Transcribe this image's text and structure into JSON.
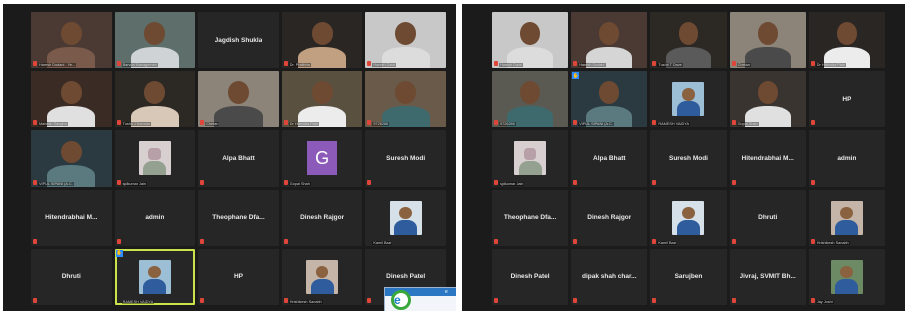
{
  "left_gallery": {
    "tiles": [
      {
        "type": "video",
        "label": "Haresh Dodani - Ye...",
        "muted": true,
        "bg": "#4a3a33",
        "body": "#7a5a4a"
      },
      {
        "type": "video",
        "label": "Barvda Managemen",
        "muted": true,
        "bg": "#5e6e6a",
        "body": "#cfd3d6"
      },
      {
        "type": "name",
        "name": "Jagdish Shukla",
        "muted": false
      },
      {
        "type": "video",
        "label": "Dr. Pratibha",
        "muted": true,
        "bg": "#2a2624",
        "body": "#c0a080"
      },
      {
        "type": "video",
        "label": "Haresh Dalal",
        "muted": true,
        "bg": "#c8c8c8",
        "body": "#dcdcdc"
      },
      {
        "type": "video",
        "label": "Mahesh Sanghvi",
        "muted": true,
        "bg": "#3a2c24",
        "body": "#e0e0e0"
      },
      {
        "type": "video",
        "label": "Tushti J Kamdar",
        "muted": true,
        "bg": "#2c2824",
        "body": "#d8c8b8"
      },
      {
        "type": "video",
        "label": "Chetan",
        "muted": true,
        "bg": "#8c8478",
        "body": "#4a4a4a"
      },
      {
        "type": "video",
        "label": "Dr Hitendra Pate",
        "muted": true,
        "bg": "#5a5040",
        "body": "#ececec"
      },
      {
        "type": "video",
        "label": "9726266",
        "muted": true,
        "bg": "#6a5a4a",
        "body": "#3e6a6e"
      },
      {
        "type": "video",
        "label": "VIPUL SIPANI (A.C.",
        "muted": true,
        "bg": "#2a3a40",
        "body": "#5a7a80"
      },
      {
        "type": "thumb",
        "style": "flower",
        "label": "sjdkumar Jain",
        "muted": true
      },
      {
        "type": "name",
        "name": "Alpa Bhatt",
        "muted": true
      },
      {
        "type": "letter",
        "letter": "G",
        "label": "Gopal Shah",
        "muted": true
      },
      {
        "type": "name",
        "name": "Suresh Modi",
        "muted": true
      },
      {
        "type": "name",
        "name": "Hitendrabhai M...",
        "muted": true
      },
      {
        "type": "name",
        "name": "admin",
        "muted": true
      },
      {
        "type": "name",
        "name": "Theophane Dfa...",
        "muted": true
      },
      {
        "type": "name",
        "name": "Dinesh Rajgor",
        "muted": true
      },
      {
        "type": "thumb",
        "style": "blue",
        "label": "Kamil Bazi",
        "muted": false
      },
      {
        "type": "name",
        "name": "Dhruti",
        "muted": true
      },
      {
        "type": "thumb",
        "style": "light",
        "label": "RAMESH VAIDYA",
        "muted": false,
        "active": true,
        "hand": true
      },
      {
        "type": "name",
        "name": "HP",
        "muted": true
      },
      {
        "type": "thumb",
        "style": "photo",
        "label": "Hrishikesh Sanabh",
        "muted": true
      },
      {
        "type": "name",
        "name": "Dinesh Patel",
        "muted": true
      }
    ],
    "popup": {
      "logo_letter": "e",
      "text": "e"
    }
  },
  "right_gallery": {
    "tiles": [
      {
        "type": "video",
        "label": "Haresh Dalal",
        "muted": true,
        "bg": "#c8c8c8",
        "body": "#dcdcdc"
      },
      {
        "type": "video",
        "label": "Haresh Dodani",
        "muted": true,
        "bg": "#4a3a33",
        "body": "#d5d5d5"
      },
      {
        "type": "video",
        "label": "Tushti T Dave",
        "muted": true,
        "bg": "#2c2824",
        "body": "#5a5a5a"
      },
      {
        "type": "video",
        "label": "Chetan",
        "muted": true,
        "bg": "#8c8478",
        "body": "#4a4a4a"
      },
      {
        "type": "video",
        "label": "Dr Hitendra Pate",
        "muted": true,
        "bg": "#2a2624",
        "body": "#ececec"
      },
      {
        "type": "video",
        "label": "9726266",
        "muted": true,
        "bg": "#5a5a52",
        "body": "#3e6a6e"
      },
      {
        "type": "video",
        "label": "VIPUL SIPANI (A.C.",
        "muted": true,
        "bg": "#2a3a40",
        "body": "#5a7a80",
        "hand": true
      },
      {
        "type": "thumb",
        "style": "light",
        "label": "RAMESH VAIDYA",
        "muted": true
      },
      {
        "type": "video",
        "label": "Gopal Shah",
        "muted": true,
        "bg": "#3a3430",
        "body": "#e0e0e0"
      },
      {
        "type": "name",
        "name": "HP",
        "muted": true
      },
      {
        "type": "thumb",
        "style": "flower",
        "label": "sjdkumar Jain",
        "muted": true
      },
      {
        "type": "name",
        "name": "Alpa Bhatt",
        "muted": true
      },
      {
        "type": "name",
        "name": "Suresh Modi",
        "muted": true
      },
      {
        "type": "name",
        "name": "Hitendrabhai M...",
        "muted": true
      },
      {
        "type": "name",
        "name": "admin",
        "muted": true
      },
      {
        "type": "name",
        "name": "Theophane Dfa...",
        "muted": true
      },
      {
        "type": "name",
        "name": "Dinesh Rajgor",
        "muted": true
      },
      {
        "type": "thumb",
        "style": "blue",
        "label": "Kamil Bazi",
        "muted": true
      },
      {
        "type": "name",
        "name": "Dhruti",
        "muted": true
      },
      {
        "type": "thumb",
        "style": "photo",
        "label": "Hrishikesh Sanabh",
        "muted": true
      },
      {
        "type": "name",
        "name": "Dinesh Patel",
        "muted": true
      },
      {
        "type": "name",
        "name": "dipak shah char...",
        "muted": true
      },
      {
        "type": "name",
        "name": "Sarujben",
        "muted": true
      },
      {
        "type": "name",
        "name": "Jivraj, SVMIT Bh...",
        "muted": true
      },
      {
        "type": "thumb",
        "style": "green",
        "label": "Jay Joshi",
        "muted": true
      }
    ]
  },
  "colors": {
    "active_speaker": "#c9e34a",
    "muted_icon": "#e0453a",
    "avatar_bg": "#8c5ab8",
    "raise_hand": "#2d8cff"
  },
  "icons": {
    "muted": "mic-muted-icon",
    "raised": "raised-hand-icon"
  }
}
